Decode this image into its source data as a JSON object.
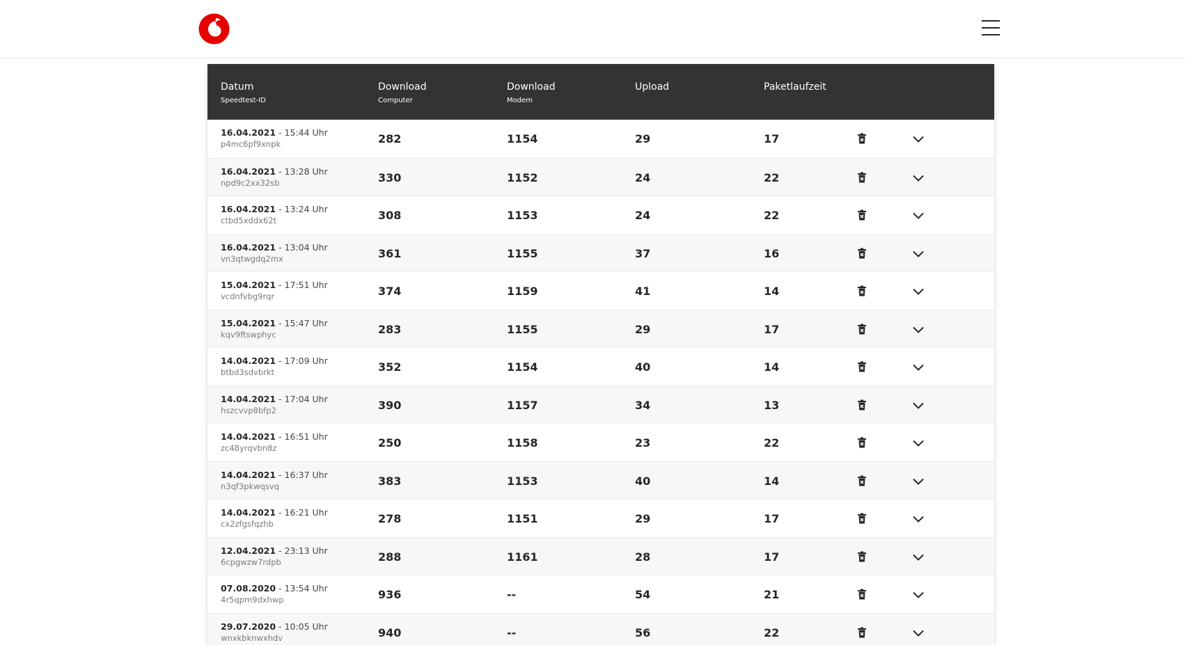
{
  "header": {
    "logo": "vodafone-logo",
    "menu_icon": "hamburger-icon"
  },
  "table": {
    "columns": [
      {
        "title": "Datum",
        "sub": "Speedtest-ID"
      },
      {
        "title": "Download",
        "sub": "Computer"
      },
      {
        "title": "Download",
        "sub": "Modem"
      },
      {
        "title": "Upload",
        "sub": ""
      },
      {
        "title": "Paketlaufzeit",
        "sub": ""
      }
    ],
    "rows": [
      {
        "date": "16.04.2021",
        "time": " - 15:44 Uhr",
        "id": "p4mc6pf9xnpk",
        "dl_computer": "282",
        "dl_modem": "1154",
        "upload": "29",
        "ping": "17"
      },
      {
        "date": "16.04.2021",
        "time": " - 13:28 Uhr",
        "id": "npd9c2xx32sb",
        "dl_computer": "330",
        "dl_modem": "1152",
        "upload": "24",
        "ping": "22"
      },
      {
        "date": "16.04.2021",
        "time": " - 13:24 Uhr",
        "id": "ctbd5xddx62t",
        "dl_computer": "308",
        "dl_modem": "1153",
        "upload": "24",
        "ping": "22"
      },
      {
        "date": "16.04.2021",
        "time": " - 13:04 Uhr",
        "id": "vn3qtwgdq2mx",
        "dl_computer": "361",
        "dl_modem": "1155",
        "upload": "37",
        "ping": "16"
      },
      {
        "date": "15.04.2021",
        "time": " - 17:51 Uhr",
        "id": "vcdnfvbg9rqr",
        "dl_computer": "374",
        "dl_modem": "1159",
        "upload": "41",
        "ping": "14"
      },
      {
        "date": "15.04.2021",
        "time": " - 15:47 Uhr",
        "id": "kqv9ftswphyc",
        "dl_computer": "283",
        "dl_modem": "1155",
        "upload": "29",
        "ping": "17"
      },
      {
        "date": "14.04.2021",
        "time": " - 17:09 Uhr",
        "id": "btbd3sdvbrkt",
        "dl_computer": "352",
        "dl_modem": "1154",
        "upload": "40",
        "ping": "14"
      },
      {
        "date": "14.04.2021",
        "time": " - 17:04 Uhr",
        "id": "hszcvvp8bfp2",
        "dl_computer": "390",
        "dl_modem": "1157",
        "upload": "34",
        "ping": "13"
      },
      {
        "date": "14.04.2021",
        "time": " - 16:51 Uhr",
        "id": "zc48yrqvbn8z",
        "dl_computer": "250",
        "dl_modem": "1158",
        "upload": "23",
        "ping": "22"
      },
      {
        "date": "14.04.2021",
        "time": " - 16:37 Uhr",
        "id": "n3qf3pkwqsvq",
        "dl_computer": "383",
        "dl_modem": "1153",
        "upload": "40",
        "ping": "14"
      },
      {
        "date": "14.04.2021",
        "time": " - 16:21 Uhr",
        "id": "cx2zfgsfqzhb",
        "dl_computer": "278",
        "dl_modem": "1151",
        "upload": "29",
        "ping": "17"
      },
      {
        "date": "12.04.2021",
        "time": " - 23:13 Uhr",
        "id": "6cpgwzw7rdpb",
        "dl_computer": "288",
        "dl_modem": "1161",
        "upload": "28",
        "ping": "17"
      },
      {
        "date": "07.08.2020",
        "time": " - 13:54 Uhr",
        "id": "4r5qpm9dxhwp",
        "dl_computer": "936",
        "dl_modem": "--",
        "upload": "54",
        "ping": "21"
      },
      {
        "date": "29.07.2020",
        "time": " - 10:05 Uhr",
        "id": "wnxkbknwxhdv",
        "dl_computer": "940",
        "dl_modem": "--",
        "upload": "56",
        "ping": "22"
      }
    ],
    "row_icons": {
      "delete": "trash-icon",
      "expand": "chevron-down-icon"
    }
  },
  "colors": {
    "brand_red": "#e60000",
    "header_bg": "#333333",
    "alt_row": "#f6f7f9"
  }
}
